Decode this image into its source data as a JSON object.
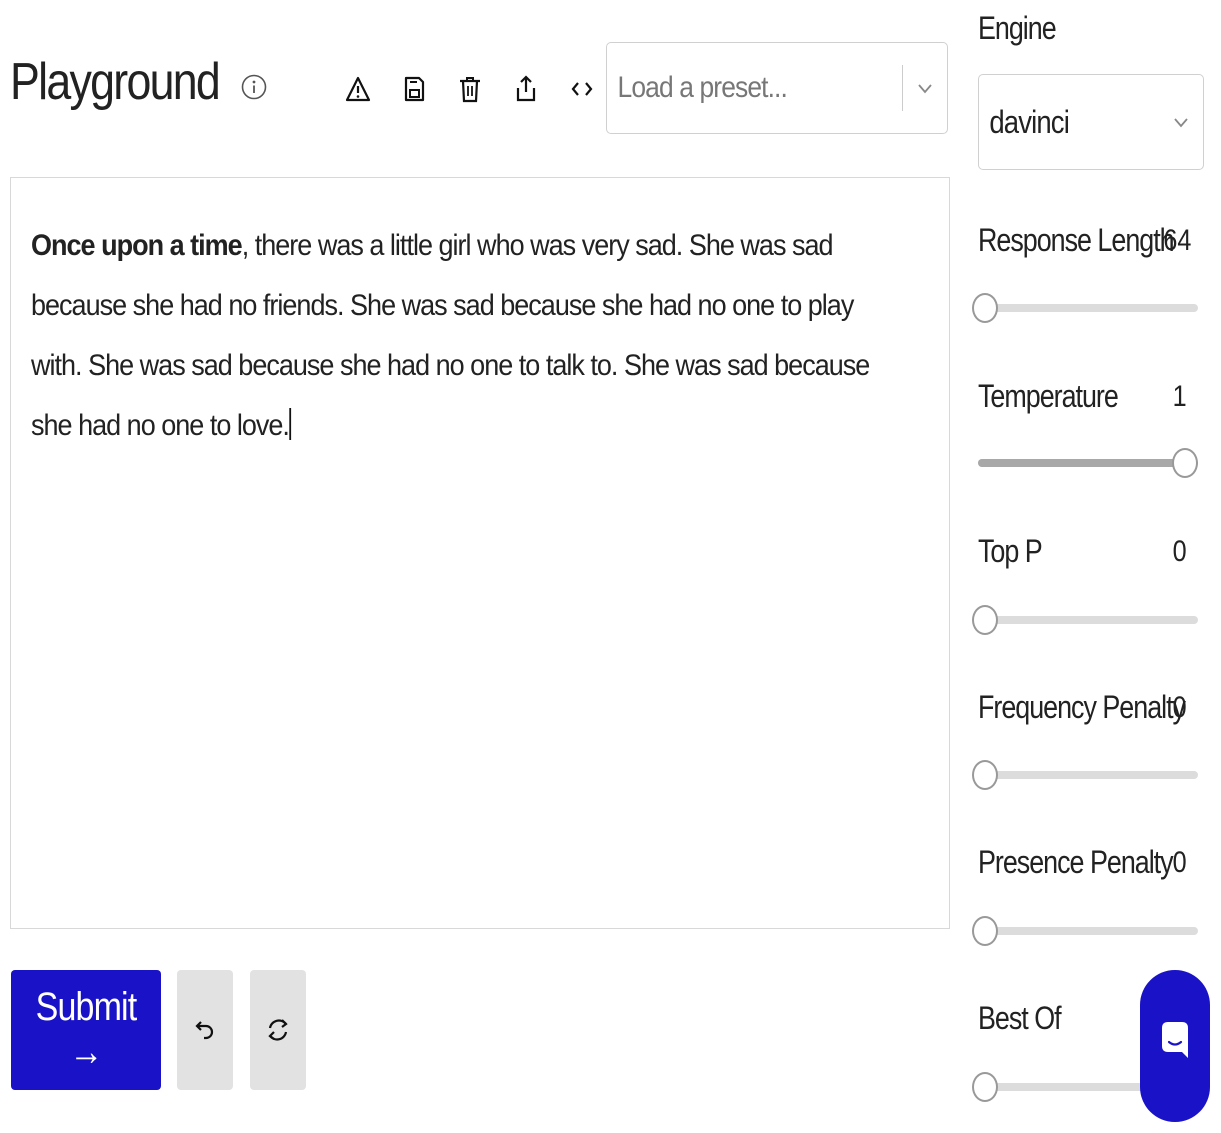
{
  "header": {
    "title": "Playground",
    "preset_placeholder": "Load a preset...",
    "toolbar_icons": [
      "warning-icon",
      "save-icon",
      "delete-icon",
      "share-icon",
      "code-icon"
    ]
  },
  "editor": {
    "bold_prefix": "Once upon a time",
    "body_text": ", there was a little girl who was very sad. She was sad because she had no friends. She was sad because she had no one to play with. She was sad because she had no one to talk to. She was sad because she had no one to love."
  },
  "actions": {
    "submit_label": "Submit →"
  },
  "sidebar": {
    "engine_label": "Engine",
    "engine_value": "davinci",
    "params": [
      {
        "label": "Response Length",
        "value": "64",
        "level": 0.0
      },
      {
        "label": "Temperature",
        "value": "1",
        "level": 1.0
      },
      {
        "label": "Top P",
        "value": "0",
        "level": 0.0
      },
      {
        "label": "Frequency Penalty",
        "value": "0",
        "level": 0.0
      },
      {
        "label": "Presence Penalty",
        "value": "0",
        "level": 0.0
      },
      {
        "label": "Best Of",
        "value": "",
        "level": 0.0
      }
    ]
  },
  "colors": {
    "primary": "#1a12c7",
    "secondary_button": "#e2e2e2"
  }
}
